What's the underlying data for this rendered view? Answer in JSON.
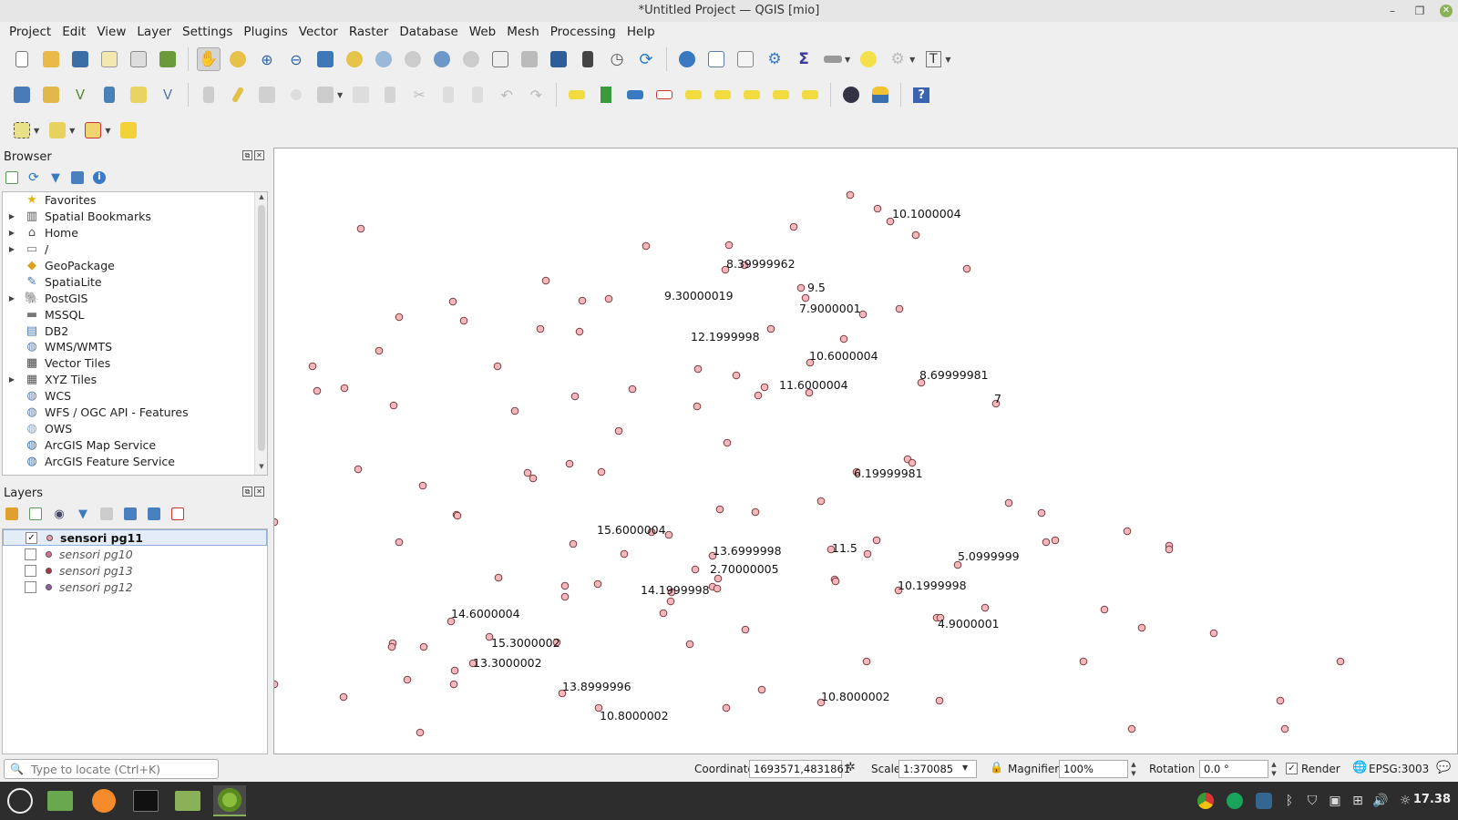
{
  "window": {
    "title": "*Untitled Project — QGIS [mio]"
  },
  "menu": [
    "Project",
    "Edit",
    "View",
    "Layer",
    "Settings",
    "Plugins",
    "Vector",
    "Raster",
    "Database",
    "Web",
    "Mesh",
    "Processing",
    "Help"
  ],
  "browser": {
    "title": "Browser",
    "items": [
      {
        "label": "Favorites",
        "icon": "star-icon",
        "expandable": false
      },
      {
        "label": "Spatial Bookmarks",
        "icon": "bookmark-icon",
        "expandable": true
      },
      {
        "label": "Home",
        "icon": "home-folder-icon",
        "expandable": true
      },
      {
        "label": "/",
        "icon": "folder-icon",
        "expandable": true
      },
      {
        "label": "GeoPackage",
        "icon": "geopackage-icon",
        "expandable": false
      },
      {
        "label": "SpatiaLite",
        "icon": "spatialite-icon",
        "expandable": false
      },
      {
        "label": "PostGIS",
        "icon": "postgis-icon",
        "expandable": true
      },
      {
        "label": "MSSQL",
        "icon": "mssql-icon",
        "expandable": false
      },
      {
        "label": "DB2",
        "icon": "db2-icon",
        "expandable": false
      },
      {
        "label": "WMS/WMTS",
        "icon": "wms-globe-icon",
        "expandable": false
      },
      {
        "label": "Vector Tiles",
        "icon": "vector-tiles-grid-icon",
        "expandable": false
      },
      {
        "label": "XYZ Tiles",
        "icon": "xyz-tiles-grid-icon",
        "expandable": true
      },
      {
        "label": "WCS",
        "icon": "wcs-globe-icon",
        "expandable": false
      },
      {
        "label": "WFS / OGC API - Features",
        "icon": "wfs-globe-icon",
        "expandable": false
      },
      {
        "label": "OWS",
        "icon": "ows-globe-icon",
        "expandable": false
      },
      {
        "label": "ArcGIS Map Service",
        "icon": "arcgis-map-icon",
        "expandable": false
      },
      {
        "label": "ArcGIS Feature Service",
        "icon": "arcgis-feature-icon",
        "expandable": false
      }
    ]
  },
  "layers": {
    "title": "Layers",
    "items": [
      {
        "name": "sensori pg11",
        "checked": true,
        "selected": true,
        "color": "#e8a0a8"
      },
      {
        "name": "sensori pg10",
        "checked": false,
        "selected": false,
        "color": "#e07090"
      },
      {
        "name": "sensori pg13",
        "checked": false,
        "selected": false,
        "color": "#b03048"
      },
      {
        "name": "sensori pg12",
        "checked": false,
        "selected": false,
        "color": "#9060a0"
      }
    ]
  },
  "map": {
    "point_color": "#f4b8bc",
    "point_stroke": "#7a3a3e",
    "labels": [
      "10.1000004",
      "8.39999962",
      "9.5",
      "9.30000019",
      "7.9000001",
      "12.1999998",
      "10.6000004",
      "8.69999981",
      "11.6000004",
      "7",
      "6.19999981",
      "15.6000004",
      "13.6999998",
      "11.5",
      "5.0999999",
      "2.70000005",
      "14.1999998",
      "10.1999998",
      "14.6000004",
      "4.9000001",
      "15.3000002",
      "13.3000002",
      "13.8999996",
      "10.8000002",
      "10.8000002"
    ]
  },
  "status": {
    "locate_placeholder": "Type to locate (Ctrl+K)",
    "coordinate_label": "Coordinate",
    "coordinate_value": "1693571,4831861",
    "scale_label": "Scale",
    "scale_value": "1:370085",
    "magnifier_label": "Magnifier",
    "magnifier_value": "100%",
    "rotation_label": "Rotation",
    "rotation_value": "0.0 °",
    "render_label": "Render",
    "render_checked": true,
    "crs": "EPSG:3003"
  },
  "taskbar": {
    "clock": "17.38"
  }
}
